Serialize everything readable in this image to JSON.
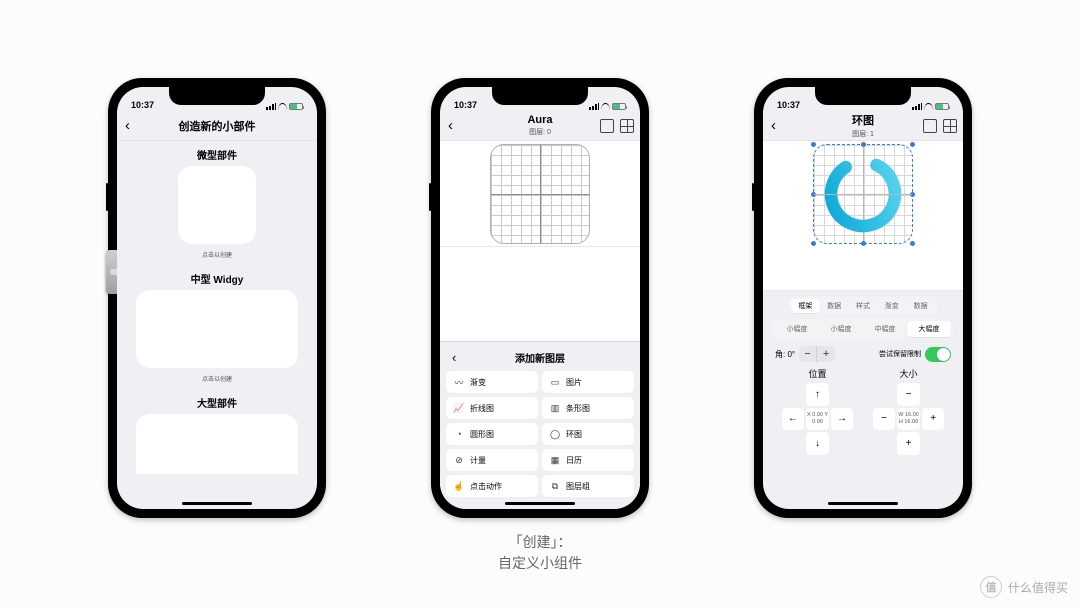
{
  "status_time": "10:37",
  "phone1": {
    "title": "创造新的小部件",
    "sect1": "微型部件",
    "sect2": "中型 Widgy",
    "sect3": "大型部件",
    "hint": "点击以创建"
  },
  "phone2": {
    "title": "Aura",
    "subtitle": "图层: 0",
    "sheet_title": "添加新图层",
    "layers": [
      {
        "icon": "〰",
        "label": "渐变"
      },
      {
        "icon": "▭",
        "label": "图片"
      },
      {
        "icon": "📈",
        "label": "折线图"
      },
      {
        "icon": "▥",
        "label": "条形图"
      },
      {
        "icon": "◔",
        "label": "圆形图"
      },
      {
        "icon": "◯",
        "label": "环图"
      },
      {
        "icon": "⊘",
        "label": "计量"
      },
      {
        "icon": "▦",
        "label": "日历"
      },
      {
        "icon": "☝",
        "label": "点击动作"
      },
      {
        "icon": "⧉",
        "label": "图层组"
      }
    ]
  },
  "phone3": {
    "title": "环图",
    "subtitle": "图层: 1",
    "tabs1": [
      "框架",
      "数据",
      "样式",
      "渐变",
      "数据"
    ],
    "tabs1_active": 0,
    "tabs2": [
      "小幅度",
      "小幅度",
      "中幅度",
      "大幅度"
    ],
    "tabs2_active": 3,
    "angle_label": "角: 0°",
    "constrain_label": "尝试保留限制",
    "pos_label": "位置",
    "size_label": "大小",
    "pos_center": "X 0.00\nY 0.00",
    "size_center": "W 16.00\nH 16.00"
  },
  "caption_line1": "「创建」：",
  "caption_line2": "自定义小组件",
  "watermark": "什么值得买"
}
